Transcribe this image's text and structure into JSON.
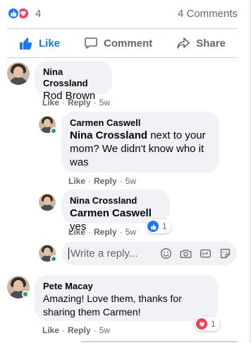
{
  "stats": {
    "reaction_count": "4",
    "comments_count": "4 Comments"
  },
  "actions": {
    "like": "Like",
    "comment": "Comment",
    "share": "Share"
  },
  "colors": {
    "accent": "#1877f2",
    "love": "#f33e58",
    "online": "#31a24c",
    "muted": "#65676b",
    "bubble": "#f0f2f5"
  },
  "comments": [
    {
      "author": "Nina Crossland",
      "text": "Rod Brown",
      "like": "Like",
      "reply": "Reply",
      "time": "5w"
    },
    {
      "author": "Carmen Caswell",
      "mention": "Nina Crossland",
      "text": " next to your mom? We didn't know who it was",
      "like": "Like",
      "reply": "Reply",
      "time": "5w"
    },
    {
      "author": "Nina Crossland",
      "mention": "Carmen Caswell",
      "text": " yes",
      "like": "Like",
      "reply": "Reply",
      "time": "5w",
      "reaction_count": "1"
    },
    {
      "author": "Pete Macay",
      "text": "Amazing! Love them, thanks for sharing them Carmen!",
      "like": "Like",
      "reply": "Reply",
      "time": "5w",
      "reaction_count": "1"
    }
  ],
  "reply_box": {
    "placeholder": "Write a reply..."
  },
  "icons": {
    "reaction_like": "thumbs-up-icon",
    "reaction_love": "heart-icon",
    "like_action": "thumbs-up-icon",
    "comment_action": "speech-bubble-icon",
    "share_action": "share-arrow-icon",
    "emoji": "emoji-icon",
    "camera": "camera-icon",
    "gif": "gif-icon",
    "sticker": "sticker-icon"
  }
}
